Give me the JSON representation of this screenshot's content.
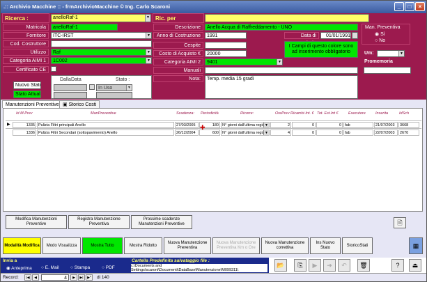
{
  "window": {
    "title": ".:: Archivio Macchine :: - frmArchivioMacchine © Ing. Carlo Scaroni"
  },
  "header": {
    "ricerca_label": "Ricerca :",
    "ricerca_value": "anelloRaf-1",
    "ric_desc_label": "Ric. per Descrizione :"
  },
  "left": {
    "matricola_label": "Matricola",
    "matricola": "anelloRaf-1",
    "fornitore_label": "Fornitore",
    "fornitore": "ITC-IRST",
    "cod_costruttore_label": "Cod. Costruttore",
    "cod_costruttore": "",
    "utilizzo_label": "Utilizzo",
    "utilizzo": "Raf",
    "categoria1_label": "Categoria AIMI 1",
    "categoria1": "1C002",
    "certificato_label": "Certificato CE",
    "nuovo_stato_label": "Nuovo Stato:",
    "stato_attuale_label": "Stato Attuale:",
    "dalla_data_label": "DallaData",
    "stato_label": "Stato :",
    "stato_value": "In Uso"
  },
  "middle": {
    "descrizione_label": "Descrizione",
    "descrizione": "Anello Acqua di Raffreddamento - UNO",
    "anno_label": "Anno di Costruzione",
    "anno": "1991",
    "data_entrata_label": "Data di entrata",
    "data_entrata": "01/01/1991",
    "cespite_label": "Cespite",
    "costo_label": "Costo di Acquisto €",
    "costo": "20000",
    "categoria2_label": "Categoria AIMI 2",
    "categoria2": "9401",
    "manuali_label": "Manuali",
    "note_label": "Nota:",
    "note": "Temp. media 15 gradi",
    "info_text": "I Campi di questo colore sono ad inserimento obbligatorio"
  },
  "right": {
    "man_prev_label": "Man. Preventiva",
    "si": "Sì",
    "no": "No",
    "um_label": "Um:",
    "promemoria_label": "Promemoria"
  },
  "tabs": [
    {
      "label": "Manutenzioni Preventive"
    },
    {
      "label": "Storico Costi"
    }
  ],
  "grid": {
    "headers": [
      "Id M.Prev",
      "ManPreventive",
      "Scadenza:",
      "Periodicità",
      "Ricorre:",
      "OrePrev",
      "Ricambi Int. €",
      "Tot. Est.Int €",
      "Esecutore",
      "Inserita",
      "IdSch"
    ],
    "rows": [
      {
        "id": "1335",
        "man": "Pulizia Filtri principali Anello",
        "scad": "27/03/2005",
        "per": "180",
        "ric": "N° giorni dall'ultima registr",
        "ore": "2",
        "ric_int": "0",
        "tot": "0",
        "exe": "fab",
        "ins": "21/07/2003",
        "idsch": "3668"
      },
      {
        "id": "1336",
        "man": "Pulizia Filtri Secondari (sottopavimento) Anello",
        "scad": "26/12/2004",
        "per": "600",
        "ric": "N° giorni dall'ultima registr",
        "ore": "4",
        "ric_int": "0",
        "tot": "0",
        "exe": "fab",
        "ins": "22/07/2003",
        "idsch": "2670"
      }
    ]
  },
  "actions": {
    "modifica_man": "Modifica Manutenzioni Preventive",
    "registra_man": "Registra Manutenzione Preventiva",
    "prossime": "Prossime scadenze Manutenzioni Preventive"
  },
  "toolbar": {
    "modalita": "Modalità Modifica",
    "visualizza": "Modo Visualizza",
    "mostra_tutto": "Mostra Tutto",
    "mostra_ridotto": "Mostra Ridotto",
    "nuova_prev": "Nuova Manutenzione Preventiva",
    "nuova_prev_km": "Nuova Manutenzione Preventiva Km o Ore",
    "nuova_corr": "Nuova Manutenzione correttiva",
    "ins_stato": "Ins Nuovo Stato",
    "storico_stati": "StoricoStati"
  },
  "bottom": {
    "invia_label": "Invia a",
    "anteprima": "Anteprima",
    "email": "E. Mail",
    "stampa": "Stampa",
    "pdf": "PDF",
    "cartella_label": "Cartella Predefinita salvataggio file :",
    "cartella_path": "c:\\Documents and Settings\\scaroni\\Documenti\\DataBase\\Manutenzione\\M099311\\"
  },
  "status": {
    "record_label": "Record:",
    "record_num": "4",
    "record_total": "di 140"
  }
}
